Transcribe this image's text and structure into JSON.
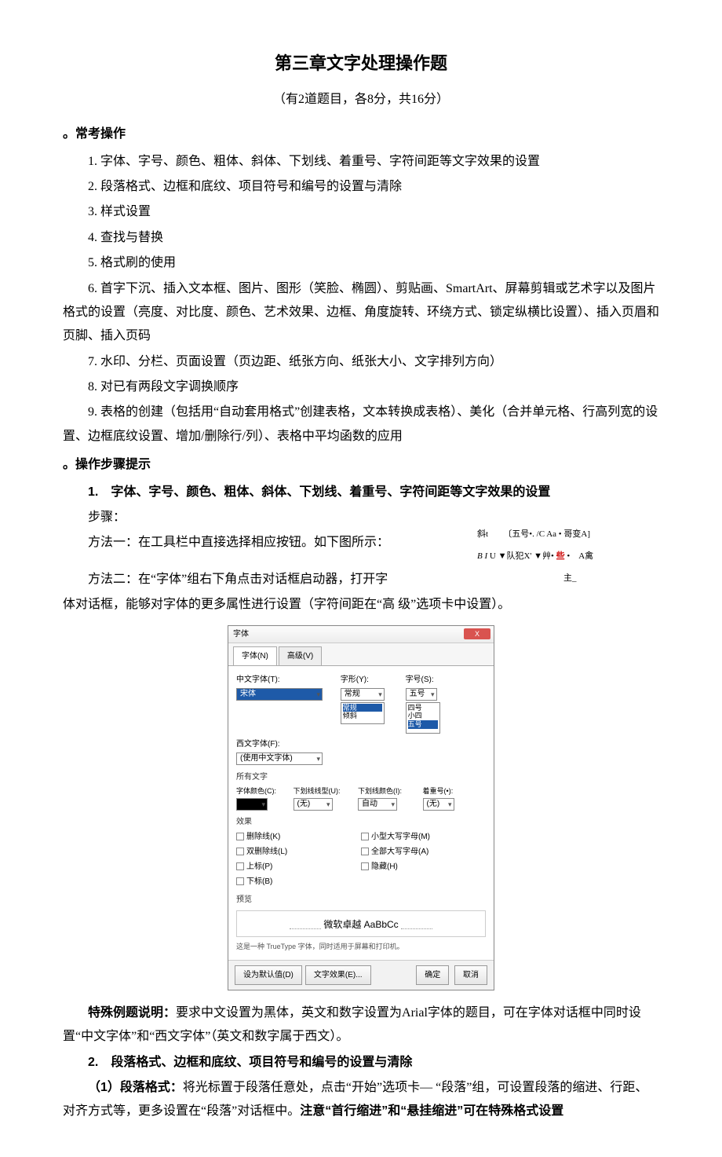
{
  "title": "第三章文字处理操作题",
  "subtitle": "（有2道题目，各8分，共16分）",
  "section1_head_prefix": "。",
  "section1_head": "常考操作",
  "ops": {
    "i1": "1. 字体、字号、颜色、粗体、斜体、下划线、着重号、字符间距等文字效果的设置",
    "i2": "2. 段落格式、边框和底纹、项目符号和编号的设置与清除",
    "i3": "3. 样式设置",
    "i4": "4. 查找与替换",
    "i5": "5. 格式刷的使用",
    "i6": "6. 首字下沉、插入文本框、图片、图形（笑脸、椭圆）、剪贴画、SmartArt、屏幕剪辑或艺术字以及图片格式的设置（亮度、对比度、颜色、艺术效果、边框、角度旋转、环绕方式、锁定纵横比设置）、插入页眉和页脚、插入页码",
    "i7": "7. 水印、分栏、页面设置（页边距、纸张方向、纸张大小、文字排列方向）",
    "i8": "8. 对已有两段文字调换顺序",
    "i9": "9. 表格的创建（包括用“自动套用格式”创建表格，文本转换成表格）、美化（合并单元格、行高列宽的设置、边框底纹设置、增加/删除行/列）、表格中平均函数的应用"
  },
  "section2_head_prefix": "。",
  "section2_head": "操作步骤提示",
  "step1_head": "1.　字体、字号、颜色、粗体、斜体、下划线、着重号、字符间距等文字效果的设置",
  "step1_label": "步骤：",
  "method1": "方法一：在工具栏中直接选择相应按钮。如下图所示：",
  "method2a": "方法二：在“字体”组右下角点击对话框启动器，打开字",
  "method2b": "体对话框，能够对字体的更多属性进行设置（字符间距在“高 级”选项卡中设置）。",
  "ribbon": {
    "l1a": "斜t",
    "l1b": "〔五号•. /C Aa • 哥变A]",
    "l2": "B I U ▼队犯X' ▼艸• 些 •　A禽",
    "red": "些",
    "l3": "主_"
  },
  "dialog": {
    "title": "字体",
    "tab1": "字体(N)",
    "tab2": "高级(V)",
    "cn_font_label": "中文字体(T):",
    "cn_font_value": "宋体",
    "style_label": "字形(Y):",
    "style_value": "常规",
    "size_label": "字号(S):",
    "size_value": "五号",
    "size_list1": "四号",
    "size_list2": "小四",
    "west_label": "西文字体(F):",
    "west_value": "(使用中文字体)",
    "style_opt1": "常规",
    "style_opt2": "倾斜",
    "all_text": "所有文字",
    "font_color": "字体颜色(C):",
    "underline_style": "下划线线型(U):",
    "underline_color": "下划线颜色(I):",
    "emphasis": "着重号(•):",
    "none": "(无)",
    "auto": "自动",
    "effects": "效果",
    "cb1": "删除线(K)",
    "cb2": "双删除线(L)",
    "cb3": "上标(P)",
    "cb4": "下标(B)",
    "cb5": "小型大写字母(M)",
    "cb6": "全部大写字母(A)",
    "cb7": "隐藏(H)",
    "preview_label": "预览",
    "preview_text": "微软卓越  AaBbCc",
    "preview_note": "这是一种 TrueType 字体，同时适用于屏幕和打印机。",
    "btn_default": "设为默认值(D)",
    "btn_text_effect": "文字效果(E)...",
    "btn_ok": "确定",
    "btn_cancel": "取消"
  },
  "special_note_label": "特殊例题说明：",
  "special_note": "要求中文设置为黑体，英文和数字设置为Arial字体的题目，可在字体对话框中同时设置“中文字体”和“西文字体”（英文和数字属于西文）。",
  "step2_head": "2.　段落格式、边框和底纹、项目符号和编号的设置与清除",
  "para1_label": "（1）段落格式：",
  "para1_text": "将光标置于段落任意处，点击“开始”选项卡— “段落”组，可设置段落的缩进、行距、对齐方式等，更多设置在“段落”对话框中。",
  "para1_bold_tail": "注意“首行缩进”和“悬挂缩进”可在特殊格式设置"
}
